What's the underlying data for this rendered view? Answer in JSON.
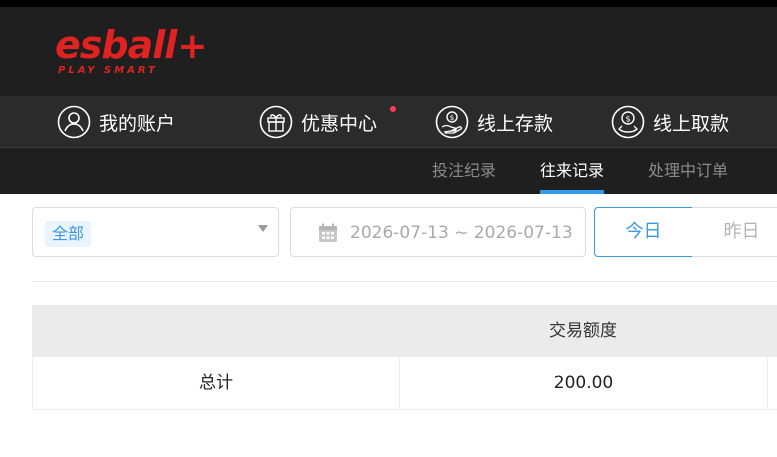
{
  "brand": {
    "name": "esball",
    "plus": "+",
    "tagline": "PLAY SMART",
    "color": "#e02222"
  },
  "main_nav": [
    {
      "label": "我的账户",
      "icon": "user-icon",
      "badge": false
    },
    {
      "label": "优惠中心",
      "icon": "gift-icon",
      "badge": true
    },
    {
      "label": "线上存款",
      "icon": "deposit-icon",
      "badge": false
    },
    {
      "label": "线上取款",
      "icon": "withdraw-icon",
      "badge": false
    }
  ],
  "sub_nav": [
    {
      "label": "投注纪录",
      "active": false
    },
    {
      "label": "往来记录",
      "active": true
    },
    {
      "label": "处理中订单",
      "active": false
    }
  ],
  "filters": {
    "type_selected": "全部",
    "date_range": "2026-07-13 ~ 2026-07-13",
    "quick_dates": [
      "今日",
      "昨日"
    ],
    "active_quick_date": "今日"
  },
  "table": {
    "headers": [
      "",
      "交易额度"
    ],
    "rows": [
      [
        "总计",
        "200.00"
      ]
    ]
  },
  "colors": {
    "accent": "#2e9bf0",
    "header_bg": "#1f1f1f",
    "badge": "#ff3b5c"
  }
}
